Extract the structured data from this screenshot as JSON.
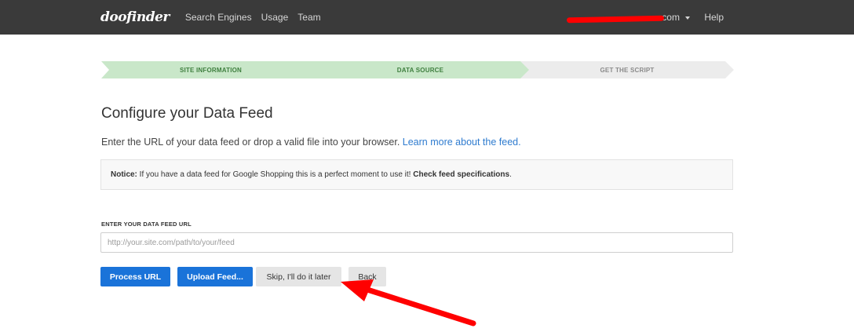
{
  "nav": {
    "brand": "doofinder",
    "links": [
      "Search Engines",
      "Usage",
      "Team"
    ],
    "account": ".com",
    "help": "Help"
  },
  "steps": [
    {
      "label": "SITE INFORMATION",
      "state": "done"
    },
    {
      "label": "DATA SOURCE",
      "state": "done"
    },
    {
      "label": "GET THE SCRIPT",
      "state": "todo"
    }
  ],
  "content": {
    "title": "Configure your Data Feed",
    "lead_text": "Enter the URL of your data feed or drop a valid file into your browser. ",
    "lead_link": "Learn more about the feed.",
    "notice_label": "Notice:",
    "notice_text": " If you have a data feed for Google Shopping this is a perfect moment to use it! ",
    "notice_link": "Check feed specifications",
    "notice_end": "."
  },
  "form": {
    "label": "ENTER YOUR DATA FEED URL",
    "placeholder": "http://your.site.com/path/to/your/feed",
    "value": ""
  },
  "buttons": {
    "process": "Process URL",
    "upload": "Upload Feed...",
    "skip": "Skip, I'll do it later",
    "back": "Back"
  },
  "colors": {
    "navbar": "#3a3a3a",
    "step_done": "#c9e7c9",
    "step_todo": "#ececec",
    "primary": "#1a73d9",
    "link": "#2e7bcf",
    "annotation": "#ff0000"
  }
}
